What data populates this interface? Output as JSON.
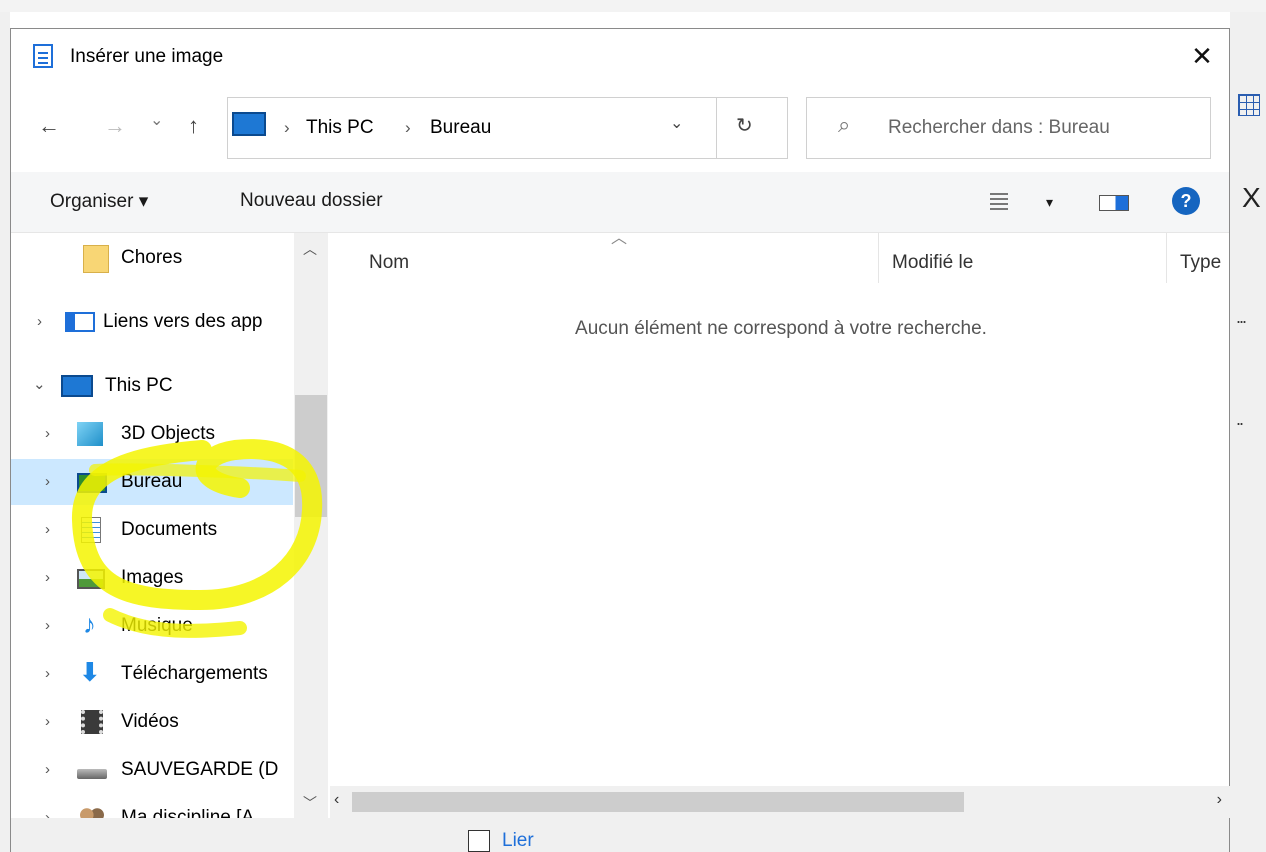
{
  "dialog": {
    "title": "Insérer une image",
    "close": "✕"
  },
  "nav": {
    "back": "←",
    "forward": "→",
    "recent": "⌄",
    "up": "↑",
    "breadcrumb": [
      "This PC",
      "Bureau"
    ],
    "dropdown": "⌄",
    "refresh": "↻"
  },
  "search": {
    "placeholder": "Rechercher dans : Bureau"
  },
  "toolbar": {
    "organize": "Organiser ▾",
    "new_folder": "Nouveau dossier",
    "view_caret": "▾",
    "help": "?"
  },
  "navpane": {
    "items": [
      {
        "label": "Chores",
        "icon": "folder-icon"
      },
      {
        "label": "Liens vers des app",
        "icon": "shortcut-icon"
      },
      {
        "label": "This PC",
        "icon": "computer-icon"
      },
      {
        "label": "3D Objects",
        "icon": "cube-icon"
      },
      {
        "label": "Bureau",
        "icon": "desktop-icon"
      },
      {
        "label": "Documents",
        "icon": "document-icon"
      },
      {
        "label": "Images",
        "icon": "picture-icon"
      },
      {
        "label": "Musique",
        "icon": "music-icon"
      },
      {
        "label": "Téléchargements",
        "icon": "download-icon"
      },
      {
        "label": "Vidéos",
        "icon": "film-icon"
      },
      {
        "label": "SAUVEGARDE (D",
        "icon": "drive-icon"
      },
      {
        "label": "Ma discipline [A",
        "icon": "network-icon"
      }
    ],
    "selected": "Bureau"
  },
  "filelist": {
    "columns": [
      "Nom",
      "Modifié le",
      "Type"
    ],
    "empty_message": "Aucun élément ne correspond à votre recherche."
  },
  "footer": {
    "link_label": "Lier"
  },
  "colors": {
    "accent": "#1e6fd9",
    "selected_bg": "#cce8ff",
    "highlighter": "#f4f400"
  }
}
